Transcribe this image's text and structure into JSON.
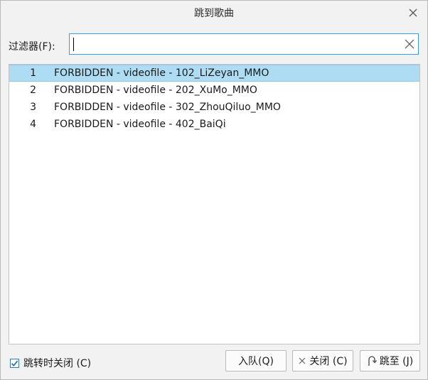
{
  "window": {
    "title": "跳到歌曲"
  },
  "filter": {
    "label": "过滤器(F):",
    "value": "",
    "placeholder": ""
  },
  "tracks": [
    {
      "num": "1",
      "name": "FORBIDDEN - videofile - 102_LiZeyan_MMO",
      "selected": true
    },
    {
      "num": "2",
      "name": "FORBIDDEN - videofile - 202_XuMo_MMO",
      "selected": false
    },
    {
      "num": "3",
      "name": "FORBIDDEN - videofile - 302_ZhouQiluo_MMO",
      "selected": false
    },
    {
      "num": "4",
      "name": "FORBIDDEN - videofile - 402_BaiQi",
      "selected": false
    }
  ],
  "options": {
    "close_after_jump_label": "跳转时关闭 (C)",
    "close_after_jump_checked": true
  },
  "buttons": {
    "enqueue": "入队(Q)",
    "close": "关闭 (C)",
    "jump": "跳至 (J)"
  },
  "colors": {
    "selection": "#aedcf3",
    "focus_border": "#3d9ae6"
  }
}
